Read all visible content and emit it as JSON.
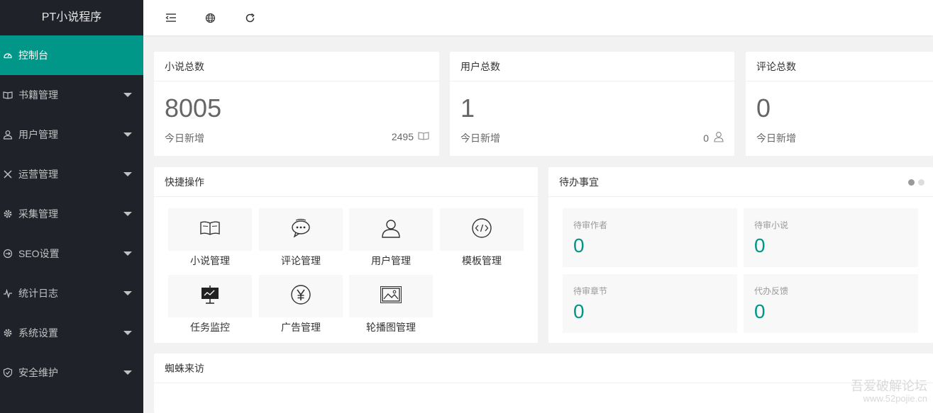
{
  "brand": {
    "title": "PT小说程序"
  },
  "sidebar": {
    "items": [
      {
        "label": "控制台",
        "icon": "dashboard-icon"
      },
      {
        "label": "书籍管理",
        "icon": "book-icon"
      },
      {
        "label": "用户管理",
        "icon": "user-icon"
      },
      {
        "label": "运营管理",
        "icon": "tools-icon"
      },
      {
        "label": "采集管理",
        "icon": "gear-icon"
      },
      {
        "label": "SEO设置",
        "icon": "seo-icon"
      },
      {
        "label": "统计日志",
        "icon": "pulse-icon"
      },
      {
        "label": "系统设置",
        "icon": "settings-icon"
      },
      {
        "label": "安全维护",
        "icon": "shield-icon"
      }
    ],
    "active_color": "#009688"
  },
  "header": {
    "icons": [
      "menu-collapse-icon",
      "globe-icon",
      "refresh-icon"
    ]
  },
  "stats": [
    {
      "title": "小说总数",
      "value": "8005",
      "sub_label": "今日新增",
      "today": "2495",
      "icon": "book-icon"
    },
    {
      "title": "用户总数",
      "value": "1",
      "sub_label": "今日新增",
      "today": "0",
      "icon": "user-icon"
    },
    {
      "title": "评论总数",
      "value": "0",
      "sub_label": "今日新增"
    }
  ],
  "quick": {
    "title": "快捷操作",
    "items": [
      {
        "label": "小说管理",
        "icon": "book-icon"
      },
      {
        "label": "评论管理",
        "icon": "chat-icon"
      },
      {
        "label": "用户管理",
        "icon": "user-icon"
      },
      {
        "label": "模板管理",
        "icon": "code-icon"
      },
      {
        "label": "任务监控",
        "icon": "monitor-icon"
      },
      {
        "label": "广告管理",
        "icon": "yen-icon"
      },
      {
        "label": "轮播图管理",
        "icon": "picture-icon"
      }
    ]
  },
  "todo": {
    "title": "待办事宜",
    "items": [
      {
        "label": "待审作者",
        "value": "0"
      },
      {
        "label": "待审小说",
        "value": "0"
      },
      {
        "label": "待审章节",
        "value": "0"
      },
      {
        "label": "代办反馈",
        "value": "0"
      }
    ]
  },
  "spider": {
    "title": "蜘蛛来访"
  },
  "watermark": {
    "line1": "吾爱破解论坛",
    "line2": "www.52pojie.cn"
  }
}
